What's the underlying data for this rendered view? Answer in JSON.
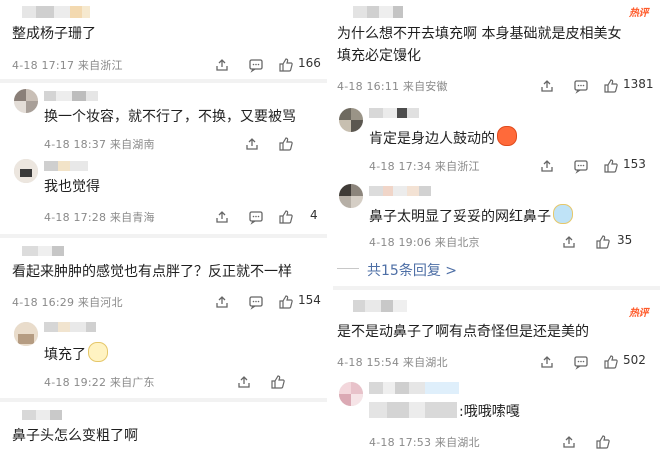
{
  "comments_left": [
    {
      "text": "整成杨子珊了",
      "date": "4-18",
      "time": "17:17",
      "location": "来自浙江",
      "likes": "166"
    },
    {
      "text": "换一个妆容，就不行了，不换，又要被骂",
      "date": "4-18",
      "time": "18:37",
      "location": "来自湖南",
      "likes": ""
    },
    {
      "text": "我也觉得",
      "date": "4-18",
      "time": "17:28",
      "location": "来自青海",
      "likes": "4"
    },
    {
      "text": "看起来肿肿的感觉也有点胖了？反正就不一样",
      "date": "4-18",
      "time": "16:29",
      "location": "来自河北",
      "likes": "154"
    },
    {
      "text": "填充了",
      "date": "4-18",
      "time": "19:22",
      "location": "来自广东",
      "likes": ""
    },
    {
      "text": "鼻子头怎么变粗了啊"
    }
  ],
  "comments_right": [
    {
      "line1": "为什么想不开去填充啊 本身基础就是皮相美女",
      "line2": "填充必定馒化",
      "date": "4-18",
      "time": "16:11",
      "location": "来自安徽",
      "likes": "1381",
      "badge": "热评"
    },
    {
      "text": "肯定是身边人鼓动的",
      "date": "4-18",
      "time": "17:34",
      "location": "来自浙江",
      "likes": "153"
    },
    {
      "text": "鼻子太明显了妥妥的网红鼻子",
      "date": "4-18",
      "time": "19:06",
      "location": "来自北京",
      "likes": "35"
    },
    {
      "replies": "共15条回复 >"
    },
    {
      "text": "是不是动鼻子了啊有点奇怪但是还是美的",
      "date": "4-18",
      "time": "15:54",
      "location": "来自湖北",
      "likes": "502",
      "badge": "热评"
    },
    {
      "text": ":哦哦嗦嘎",
      "date": "4-18",
      "time": "17:53",
      "location": "来自湖北",
      "likes": ""
    }
  ]
}
